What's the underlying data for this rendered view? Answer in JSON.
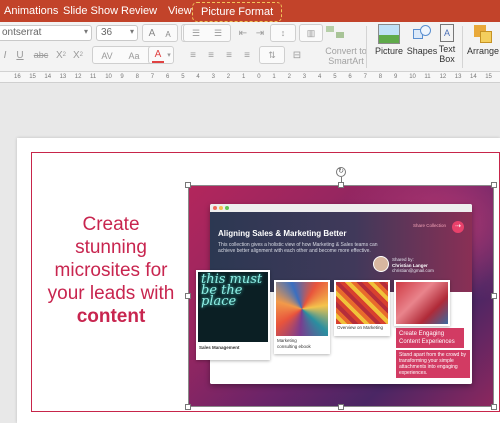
{
  "ribbon": {
    "tabs": [
      {
        "label": "Animations"
      },
      {
        "label": "Slide Show"
      },
      {
        "label": "Review"
      },
      {
        "label": "View"
      },
      {
        "label": "Picture Format",
        "active": true
      }
    ]
  },
  "toolbar": {
    "font_name": "ontserrat",
    "font_size": "36",
    "increase_font": "A",
    "decrease_font": "A",
    "italic": "I",
    "underline": "U",
    "strikethrough": "abc",
    "superscript": "X",
    "subscript": "X",
    "char_spacing": "AV",
    "change_case": "Aa",
    "font_color": "A",
    "convert_smartart_line1": "Convert to",
    "convert_smartart_line2": "SmartArt",
    "picture": "Picture",
    "shapes": "Shapes",
    "textbox_line1": "Text",
    "textbox_line2": "Box",
    "arrange": "Arrange"
  },
  "ruler": {
    "ticks": [
      "16",
      "15",
      "14",
      "13",
      "12",
      "11",
      "10",
      "9",
      "8",
      "7",
      "6",
      "5",
      "4",
      "3",
      "2",
      "1",
      "0",
      "1",
      "2",
      "3",
      "4",
      "5",
      "6",
      "7",
      "8",
      "9",
      "10",
      "11",
      "12",
      "13",
      "14",
      "15"
    ]
  },
  "slide": {
    "headline_line1": "Create",
    "headline_line2": "stunning",
    "headline_line3": "microsites for",
    "headline_line4": "your leads with",
    "headline_bold": "content",
    "accent_color": "#c8254f",
    "picture": {
      "page_title": "Aligning Sales & Marketing Better",
      "page_desc": "This collection gives a holistic view of how Marketing & Sales teams can achieve better alignment with each other and become more effective.",
      "share_label": "Share Collection",
      "shared_by": "Shared by:",
      "author": "Christian Langer",
      "email": "christian@gmail.com",
      "neon_text": "this must be the place",
      "card1_caption": "Sales Management",
      "card2_caption_line1": "Marketing",
      "card2_caption_line2": "consulting ebook",
      "card3_caption": "Overview on Marketing",
      "card4_title_line1": "Create Engaging",
      "card4_title_line2": "Content Experiences",
      "card4_desc": "Stand apart from the crowd by transforming your simple attachments into engaging experiences."
    }
  }
}
